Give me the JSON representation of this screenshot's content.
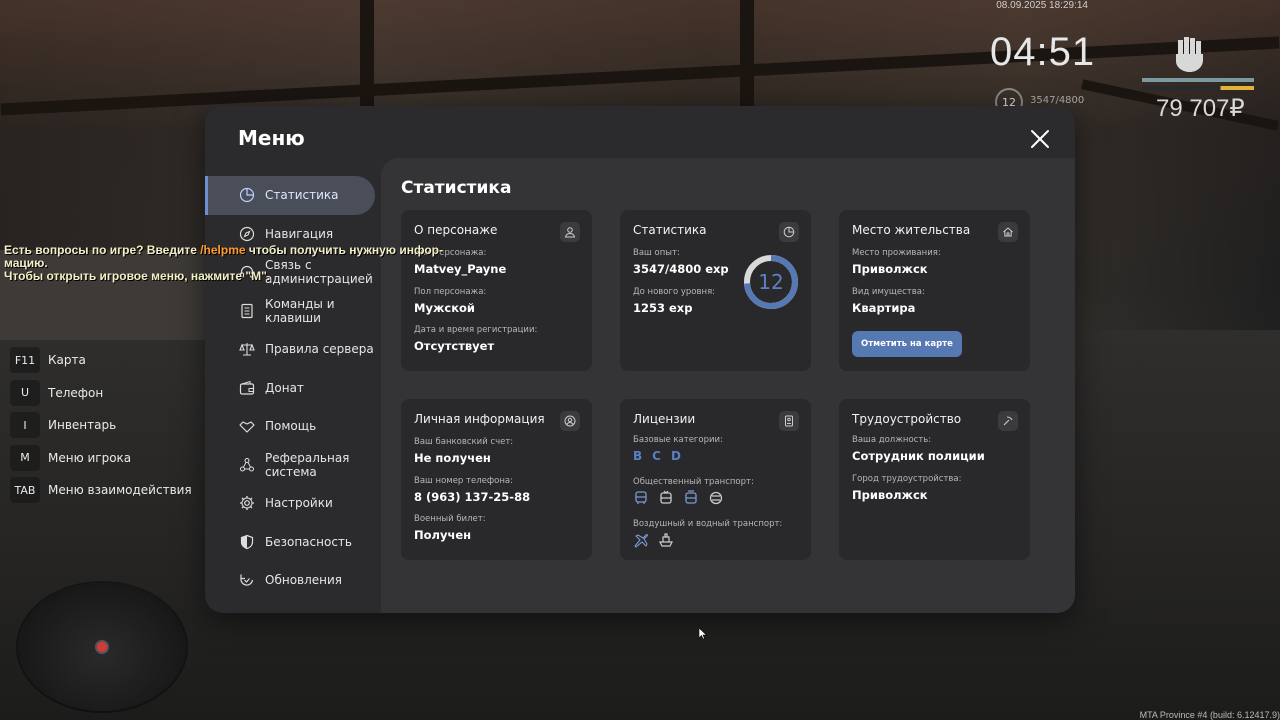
{
  "hud": {
    "datetime": "08.09.2025 18:29:14",
    "time": "04:51",
    "level": "12",
    "exp": "3547/4800",
    "money": "79 707₽",
    "build": "MTA Province #4 (build: 6.12417.9)"
  },
  "chat": {
    "line1_a": "Есть вопросы по игре? Введите ",
    "line1_cmd": "/helpme",
    "line1_b": " чтобы получить нужную инфор-",
    "line2": "мацию.",
    "line3": "Чтобы открыть игровое меню, нажмите \"M\"."
  },
  "keys": [
    {
      "key": "F11",
      "label": "Карта"
    },
    {
      "key": "U",
      "label": "Телефон"
    },
    {
      "key": "I",
      "label": "Инвентарь"
    },
    {
      "key": "M",
      "label": "Меню игрока"
    },
    {
      "key": "TAB",
      "label": "Меню взаимодействия"
    }
  ],
  "menu": {
    "title": "Меню",
    "nav": [
      {
        "label": "Статистика",
        "icon": "pie-chart-icon",
        "active": true
      },
      {
        "label": "Навигация",
        "icon": "compass-icon"
      },
      {
        "label": "Связь с администрацией",
        "icon": "headset-icon"
      },
      {
        "label": "Команды и клавиши",
        "icon": "document-icon"
      },
      {
        "label": "Правила сервера",
        "icon": "scales-icon"
      },
      {
        "label": "Донат",
        "icon": "wallet-icon"
      },
      {
        "label": "Помощь",
        "icon": "handshake-icon"
      },
      {
        "label": "Реферальная система",
        "icon": "network-icon"
      },
      {
        "label": "Настройки",
        "icon": "gear-icon"
      },
      {
        "label": "Безопасность",
        "icon": "shield-icon"
      },
      {
        "label": "Обновления",
        "icon": "refresh-icon"
      }
    ],
    "section_title": "Статистика",
    "cards": {
      "character": {
        "title": "О персонаже",
        "name_label": "Ник персонажа:",
        "name": "Matvey_Payne",
        "sex_label": "Пол персонажа:",
        "sex": "Мужской",
        "reg_label": "Дата и время регистрации:",
        "reg": "Отсутствует"
      },
      "stats": {
        "title": "Статистика",
        "exp_label": "Ваш опыт:",
        "exp": "3547/4800 exp",
        "next_label": "До нового уровня:",
        "next": "1253 exp",
        "level": "12",
        "progress": 0.739
      },
      "residence": {
        "title": "Место жительства",
        "place_label": "Место проживания:",
        "place": "Приволжск",
        "property_label": "Вид имущества:",
        "property": "Квартира",
        "button": "Отметить на карте"
      },
      "personal": {
        "title": "Личная информация",
        "bank_label": "Ваш банковский счет:",
        "bank": "Не получен",
        "phone_label": "Ваш номер телефона:",
        "phone": "8 (963) 137-25-88",
        "military_label": "Военный билет:",
        "military": "Получен"
      },
      "licenses": {
        "title": "Лицензии",
        "base_label": "Базовые категории:",
        "categories": [
          "B",
          "C",
          "D"
        ],
        "public_label": "Общественный транспорт:",
        "air_label": "Воздушный и водный транспорт:"
      },
      "employment": {
        "title": "Трудоустройство",
        "position_label": "Ваша должность:",
        "position": "Сотрудник полиции",
        "city_label": "Город трудоустройства:",
        "city": "Приволжск"
      }
    }
  },
  "colors": {
    "accent": "#5779b3",
    "panel": "#2b2b2d",
    "card": "#29292b",
    "chat_cmd": "#ff9a2e"
  }
}
